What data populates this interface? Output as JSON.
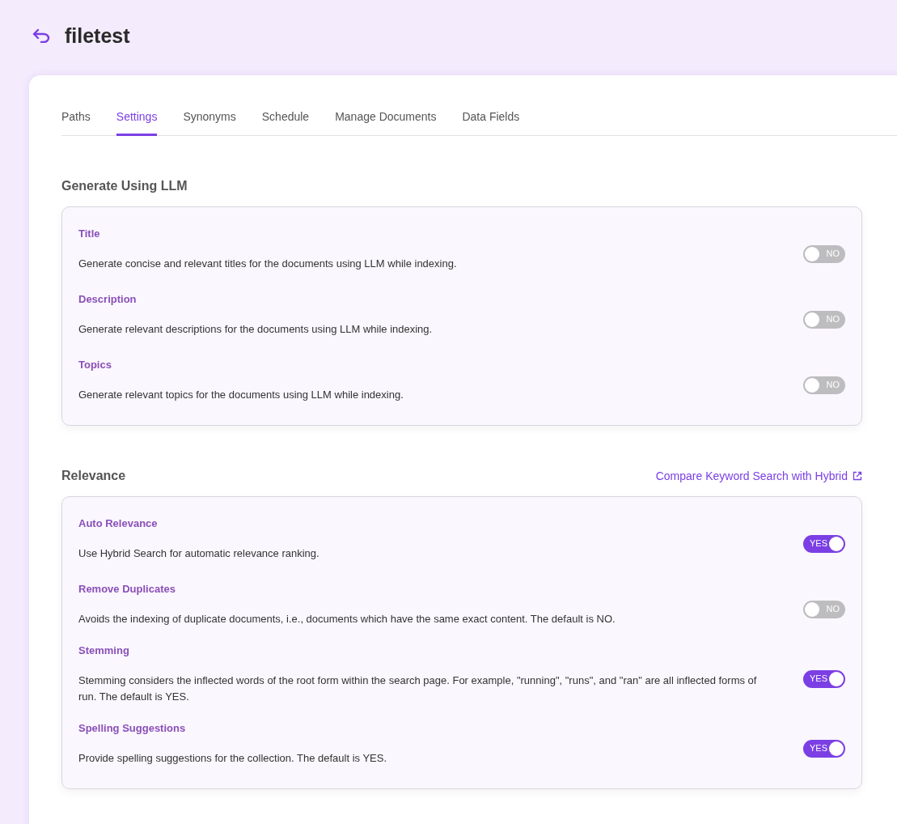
{
  "header": {
    "title": "filetest"
  },
  "tabs": [
    {
      "label": "Paths",
      "selected": false
    },
    {
      "label": "Settings",
      "selected": true
    },
    {
      "label": "Synonyms",
      "selected": false
    },
    {
      "label": "Schedule",
      "selected": false
    },
    {
      "label": "Manage Documents",
      "selected": false
    },
    {
      "label": "Data Fields",
      "selected": false
    }
  ],
  "sections": [
    {
      "heading": "Generate Using LLM",
      "settings": [
        {
          "title": "Title",
          "description": "Generate concise and relevant titles for the documents using LLM while indexing.",
          "on": false,
          "toggle_label": "NO"
        },
        {
          "title": "Description",
          "description": "Generate relevant descriptions for the documents using LLM while indexing.",
          "on": false,
          "toggle_label": "NO"
        },
        {
          "title": "Topics",
          "description": "Generate relevant topics for the documents using LLM while indexing.",
          "on": false,
          "toggle_label": "NO"
        }
      ]
    },
    {
      "heading": "Relevance",
      "link": "Compare Keyword Search with Hybrid",
      "settings": [
        {
          "title": "Auto Relevance",
          "description": "Use Hybrid Search for automatic relevance ranking.",
          "on": true,
          "toggle_label": "YES"
        },
        {
          "title": "Remove Duplicates",
          "description": "Avoids the indexing of duplicate documents, i.e., documents which have the same exact content. The default is NO.",
          "on": false,
          "toggle_label": "NO"
        },
        {
          "title": "Stemming",
          "description": "Stemming considers the inflected words of the root form within the search page. For example, \"running\", \"runs\", and \"ran\" are all inflected forms of run. The default is YES.",
          "on": true,
          "toggle_label": "YES"
        },
        {
          "title": "Spelling Suggestions",
          "description": "Provide spelling suggestions for the collection. The default is YES.",
          "on": true,
          "toggle_label": "YES"
        }
      ]
    }
  ]
}
